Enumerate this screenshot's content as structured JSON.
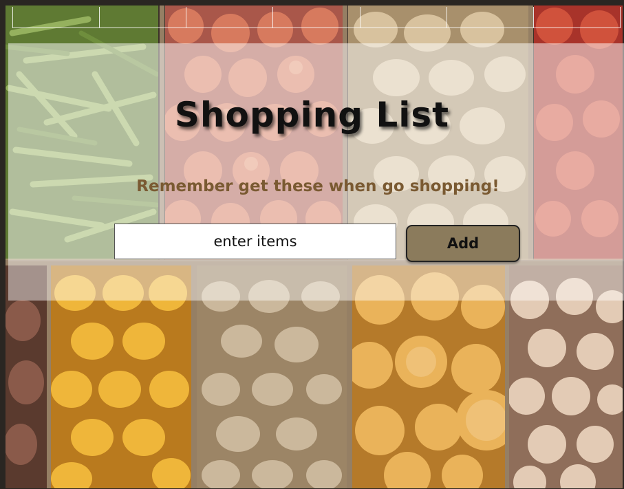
{
  "header": {
    "title": "Shopping List",
    "subtitle": "Remember get these when go shopping!"
  },
  "form": {
    "item_placeholder": "enter items",
    "add_label": "Add"
  },
  "background": {
    "produce": [
      "green-beans",
      "apples",
      "potatoes",
      "tomatoes",
      "lemons",
      "potatoes",
      "melons",
      "onions"
    ],
    "colors": {
      "green-beans": "#7e9a4a",
      "apples": "#c86a4a",
      "potatoes": "#c9ad85",
      "tomatoes": "#c8412c",
      "lemons": "#e3a32e",
      "melons": "#e1ac4e",
      "onions": "#d7c0a8",
      "crate": "#6b4f38"
    }
  }
}
